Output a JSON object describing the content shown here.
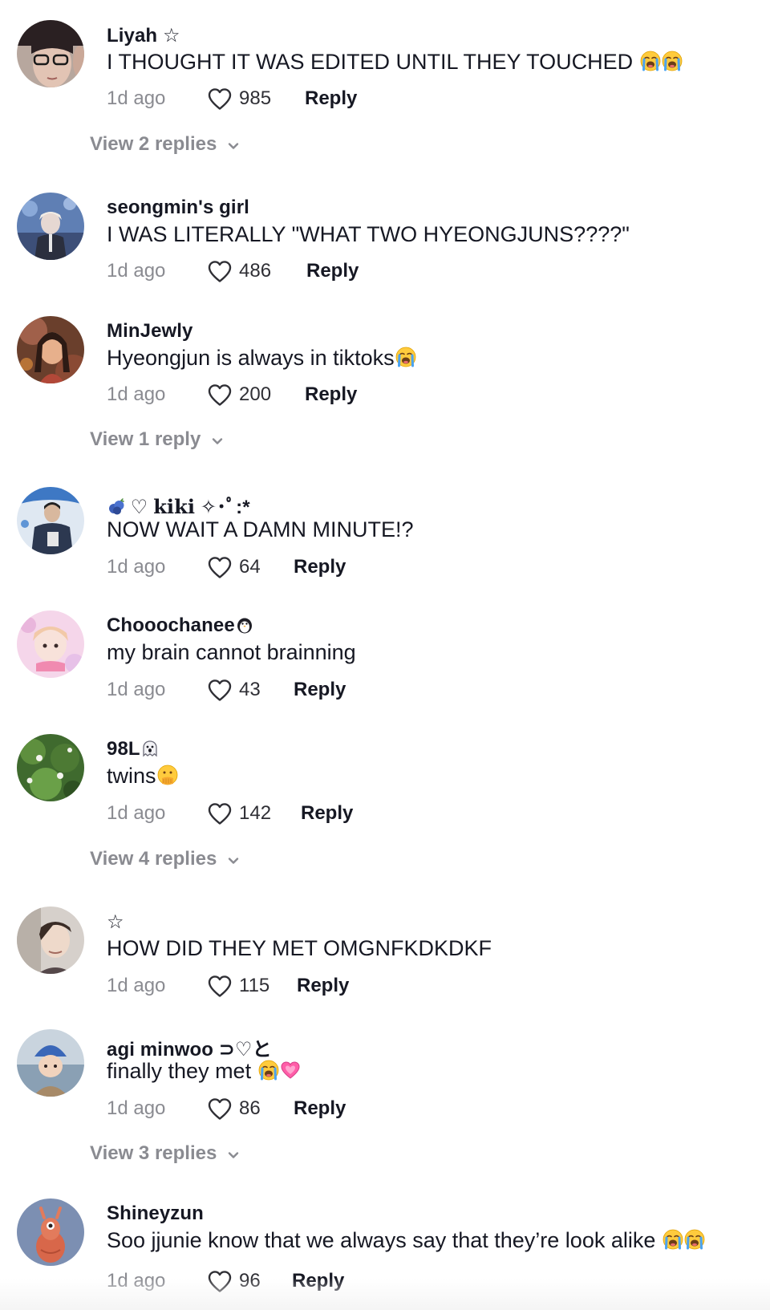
{
  "comments": [
    {
      "username": "Liyah ☆",
      "text": "I THOUGHT IT WAS EDITED UNTIL THEY TOUCHED",
      "time": "1d ago",
      "likes": "985",
      "reply_label": "Reply",
      "view_replies": "View 2 replies",
      "text_emoji": "loudly-crying-face x2"
    },
    {
      "username": "seongmin's girl",
      "text": "I WAS LITERALLY \"WHAT TWO HYEONGJUNS????\"",
      "time": "1d ago",
      "likes": "486",
      "reply_label": "Reply"
    },
    {
      "username": "MinJewly",
      "text": "Hyeongjun is always in tiktoks",
      "time": "1d ago",
      "likes": "200",
      "reply_label": "Reply",
      "view_replies": "View 1 reply",
      "text_emoji": "loudly-crying-face"
    },
    {
      "username_prefix": "♡",
      "username": "kiki",
      "username_suffix": "✧･ﾟ:*",
      "text": "NOW WAIT A DAMN MINUTE!?",
      "time": "1d ago",
      "likes": "64",
      "reply_label": "Reply",
      "username_emoji": "blueberries"
    },
    {
      "username": "Chooochanee",
      "text": "my brain cannot brainning",
      "time": "1d ago",
      "likes": "43",
      "reply_label": "Reply",
      "username_emoji": "penguin"
    },
    {
      "username": "98L",
      "text": "twins",
      "time": "1d ago",
      "likes": "142",
      "reply_label": "Reply",
      "view_replies": "View 4 replies",
      "username_emoji": "ghost",
      "text_emoji": "face-with-hand-over-mouth"
    },
    {
      "username": "☆",
      "text": "HOW DID THEY MET OMGNFKDKDKF",
      "time": "1d ago",
      "likes": "115",
      "reply_label": "Reply"
    },
    {
      "username": "agi minwoo ⊃♡と",
      "text": "finally they met",
      "time": "1d ago",
      "likes": "86",
      "reply_label": "Reply",
      "view_replies": "View 3 replies",
      "text_emoji": "loudly-crying-face, growing-heart"
    },
    {
      "username": "Shineyzun",
      "text": "Soo jjunie know that we always say that they’re look alike",
      "time": "1d ago",
      "likes": "96",
      "reply_label": "Reply",
      "text_emoji": "loudly-crying-face x2"
    }
  ],
  "icons": {
    "like": "heart-outline-icon",
    "expand": "chevron-down-icon"
  },
  "colors": {
    "text": "#161823",
    "secondary": "#8a8b91",
    "background": "#ffffff"
  }
}
